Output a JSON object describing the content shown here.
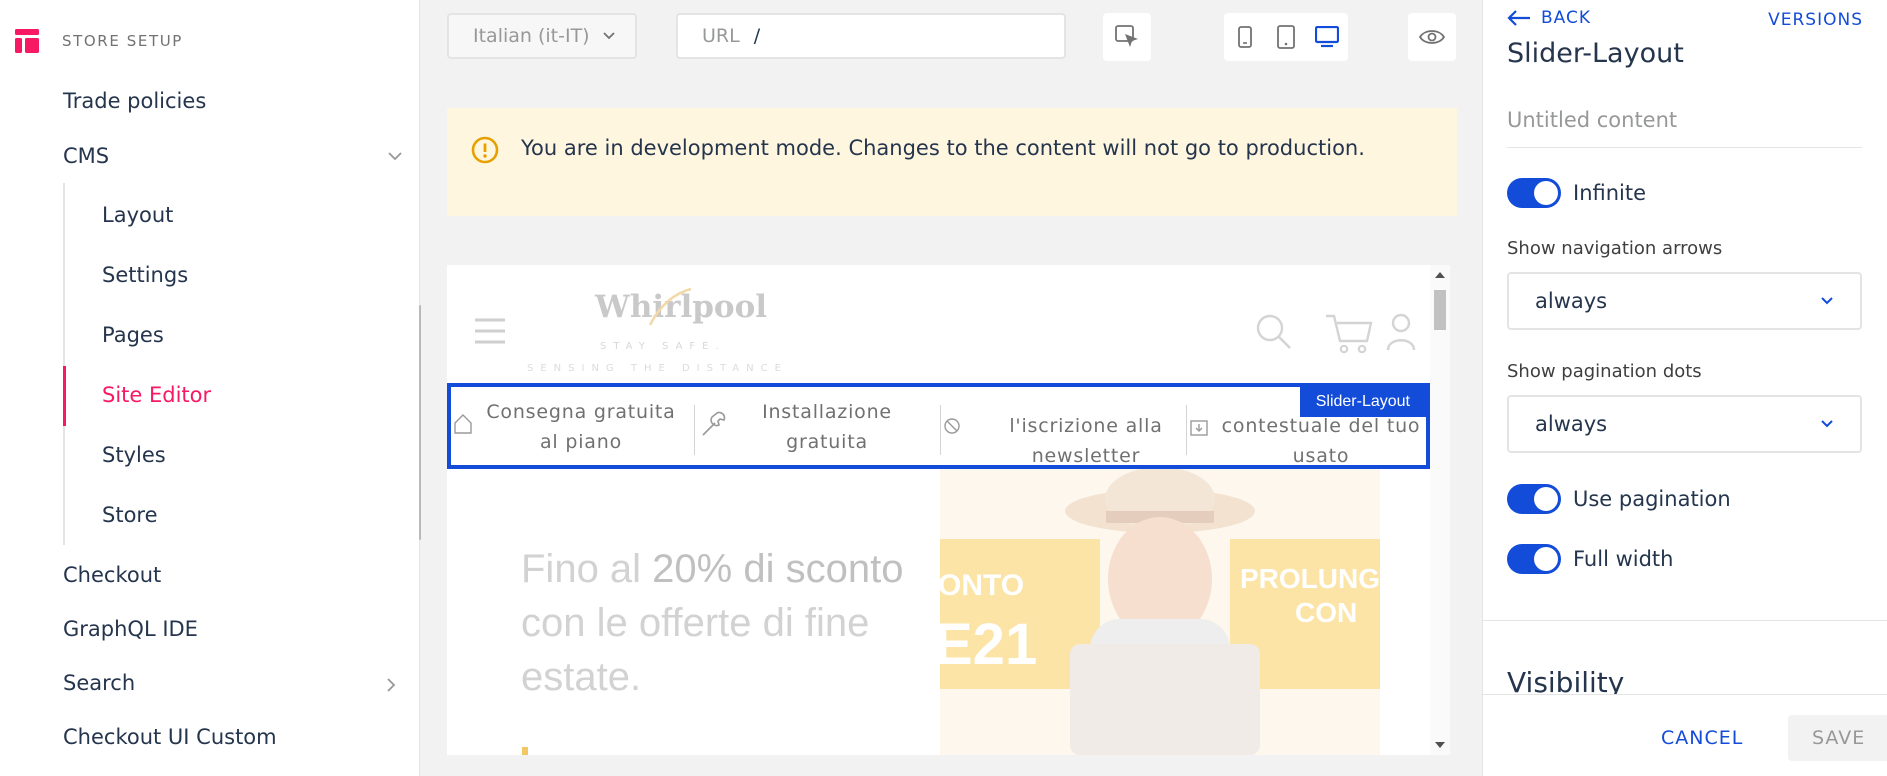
{
  "sidebar": {
    "header": "STORE SETUP",
    "items": [
      {
        "label": "Trade policies"
      },
      {
        "label": "CMS"
      },
      {
        "label": "Checkout"
      },
      {
        "label": "GraphQL IDE"
      },
      {
        "label": "Search"
      },
      {
        "label": "Checkout UI Custom"
      }
    ],
    "cms_children": [
      {
        "label": "Layout"
      },
      {
        "label": "Settings"
      },
      {
        "label": "Pages"
      },
      {
        "label": "Site Editor"
      },
      {
        "label": "Styles"
      },
      {
        "label": "Store"
      }
    ],
    "active_item": "Site Editor"
  },
  "toolbar": {
    "locale": "Italian (it-IT)",
    "url_label": "URL",
    "url_value": "/",
    "devices": [
      "mobile",
      "tablet",
      "desktop"
    ],
    "active_device": "desktop"
  },
  "banner": {
    "text": "You are in development mode. Changes to the content will not go to production."
  },
  "preview": {
    "brand": "Whirlpool",
    "tagline": "STAY SAFE.",
    "tagline2": "SENSING THE DISTANCE",
    "block_label": "Slider-Layout",
    "slides": [
      {
        "line1": "Consegna gratuita",
        "line2": "al piano"
      },
      {
        "line1": "Installazione",
        "line2": "gratuita"
      },
      {
        "line1": "l'iscrizione alla",
        "line2": "newsletter"
      },
      {
        "line1": "contestuale del tuo",
        "line2": "usato"
      }
    ],
    "hero": {
      "line1_a": "Fino al ",
      "line1_b": "20% di sconto",
      "line2": "con le offerte di fine",
      "line3": "estate."
    },
    "hero_image": {
      "left_big": "E21",
      "left_small": "ONTO",
      "right_1": "PROLUNG",
      "right_2": "CON"
    }
  },
  "panel": {
    "back_label": "BACK",
    "versions_label": "VERSIONS",
    "title": "Slider-Layout",
    "content_placeholder": "Untitled content",
    "infinite_label": "Infinite",
    "infinite_on": true,
    "nav_arrows_label": "Show navigation arrows",
    "nav_arrows_value": "always",
    "pagination_dots_label": "Show pagination dots",
    "pagination_dots_value": "always",
    "use_pagination_label": "Use pagination",
    "use_pagination_on": true,
    "full_width_label": "Full width",
    "full_width_on": true,
    "visibility_label": "Visibility",
    "cancel_label": "CANCEL",
    "save_label": "SAVE"
  },
  "colors": {
    "accent": "#134cd8",
    "active_nav": "#f71963",
    "warning_bg": "#fff6e0",
    "warning_icon": "#e6a000"
  }
}
